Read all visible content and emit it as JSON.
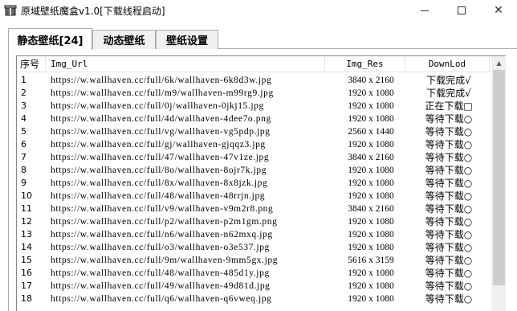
{
  "window": {
    "title": "原域壁纸魔盒v1.0[下载线程启动]",
    "icon": "app-box-icon",
    "minimize_icon": "minimize-icon",
    "maximize_icon": "maximize-icon",
    "close_icon": "close-icon",
    "close_glyph": "✕"
  },
  "tabs": [
    {
      "label": "静态壁纸[24]",
      "active": true
    },
    {
      "label": "动态壁纸",
      "active": false
    },
    {
      "label": "壁纸设置",
      "active": false
    }
  ],
  "table": {
    "columns": {
      "no": "序号",
      "url": "Img_Url",
      "res": "Img_Res",
      "dl": "DownLod"
    },
    "rows": [
      {
        "no": "1",
        "url": "https://w.wallhaven.cc/full/6k/wallhaven-6k8d3w.jpg",
        "res": "3840 x 2160",
        "dl": "下载完成√"
      },
      {
        "no": "2",
        "url": "https://w.wallhaven.cc/full/m9/wallhaven-m99rg9.jpg",
        "res": "1920 x 1080",
        "dl": "下载完成√"
      },
      {
        "no": "3",
        "url": "https://w.wallhaven.cc/full/0j/wallhaven-0jkj15.jpg",
        "res": "1920 x 1080",
        "dl": "正在下载□"
      },
      {
        "no": "4",
        "url": "https://w.wallhaven.cc/full/4d/wallhaven-4dee7o.png",
        "res": "1920 x 1080",
        "dl": "等待下载○"
      },
      {
        "no": "5",
        "url": "https://w.wallhaven.cc/full/vg/wallhaven-vg5pdp.jpg",
        "res": "2560 x 1440",
        "dl": "等待下载○"
      },
      {
        "no": "6",
        "url": "https://w.wallhaven.cc/full/gj/wallhaven-gjqqz3.jpg",
        "res": "1920 x 1080",
        "dl": "等待下载○"
      },
      {
        "no": "7",
        "url": "https://w.wallhaven.cc/full/47/wallhaven-47v1ze.jpg",
        "res": "3840 x 2160",
        "dl": "等待下载○"
      },
      {
        "no": "8",
        "url": "https://w.wallhaven.cc/full/8o/wallhaven-8ojr7k.jpg",
        "res": "1920 x 1080",
        "dl": "等待下载○"
      },
      {
        "no": "9",
        "url": "https://w.wallhaven.cc/full/8x/wallhaven-8x8jzk.jpg",
        "res": "1920 x 1080",
        "dl": "等待下载○"
      },
      {
        "no": "10",
        "url": "https://w.wallhaven.cc/full/48/wallhaven-48rrjn.jpg",
        "res": "1920 x 1080",
        "dl": "等待下载○"
      },
      {
        "no": "11",
        "url": "https://w.wallhaven.cc/full/v9/wallhaven-v9m2r8.png",
        "res": "3840 x 2160",
        "dl": "等待下载○"
      },
      {
        "no": "12",
        "url": "https://w.wallhaven.cc/full/p2/wallhaven-p2m1gm.png",
        "res": "1920 x 1080",
        "dl": "等待下载○"
      },
      {
        "no": "13",
        "url": "https://w.wallhaven.cc/full/n6/wallhaven-n62mxq.jpg",
        "res": "1920 x 1080",
        "dl": "等待下载○"
      },
      {
        "no": "14",
        "url": "https://w.wallhaven.cc/full/o3/wallhaven-o3e537.jpg",
        "res": "1920 x 1080",
        "dl": "等待下载○"
      },
      {
        "no": "15",
        "url": "https://w.wallhaven.cc/full/9m/wallhaven-9mm5gx.jpg",
        "res": "5616 x 3159",
        "dl": "等待下载○"
      },
      {
        "no": "16",
        "url": "https://w.wallhaven.cc/full/48/wallhaven-485d1y.jpg",
        "res": "1920 x 1080",
        "dl": "等待下载○"
      },
      {
        "no": "17",
        "url": "https://w.wallhaven.cc/full/49/wallhaven-49d81d.jpg",
        "res": "1920 x 1080",
        "dl": "等待下载○"
      },
      {
        "no": "18",
        "url": "https://w.wallhaven.cc/full/q6/wallhaven-q6vweq.jpg",
        "res": "1920 x 1080",
        "dl": "等待下载○"
      }
    ]
  },
  "scrollbar": {
    "up_icon": "scroll-up-arrow-icon",
    "up_glyph": "▲",
    "thumb_fraction": 0.75
  }
}
